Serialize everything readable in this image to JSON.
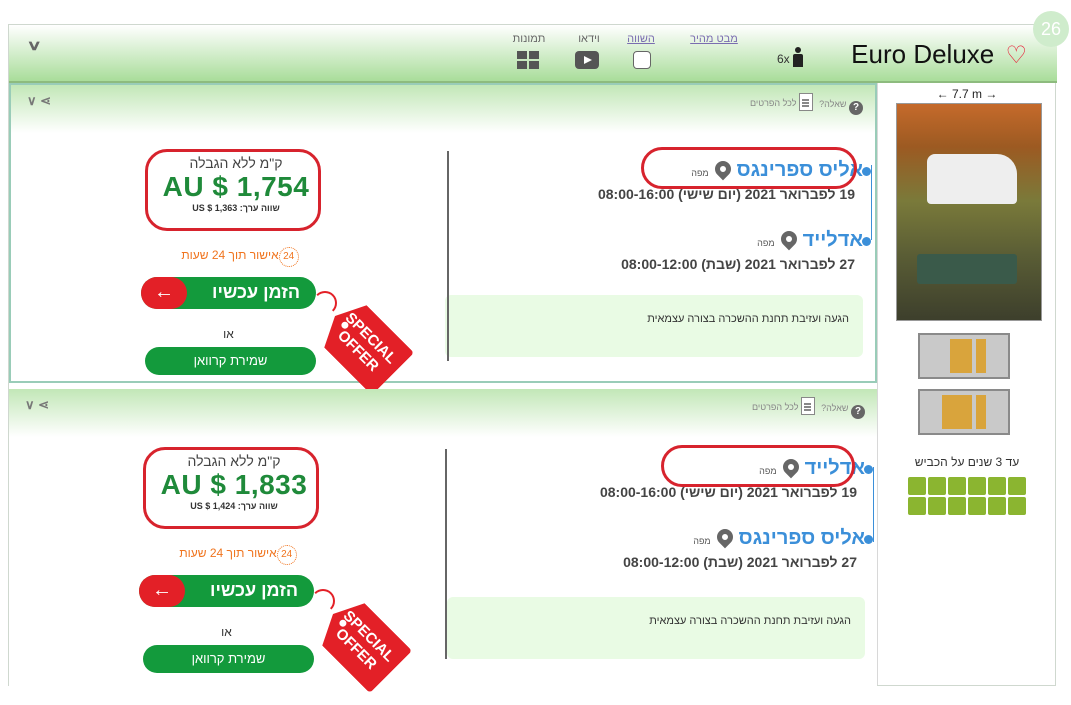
{
  "rank": "26",
  "vehicle": {
    "name": "Euro Deluxe",
    "heart": "♡",
    "passengers": "6x"
  },
  "header_links": {
    "quick_view": "מבט מהיר",
    "compare": "השווה",
    "video": "וידאו",
    "photos": "תמונות"
  },
  "offers": [
    {
      "question": "שאלה?",
      "details": "לכל הפרטים",
      "pickup": {
        "city": "אליס ספרינגס",
        "map": "מפה",
        "datetime": "19 לפברואר 2021 (יום שישי) 08:00-16:00"
      },
      "dropoff": {
        "city": "אדלייד",
        "map": "מפה",
        "datetime": "27 לפברואר 2021 (שבת) 08:00-12:00"
      },
      "note": "הגעה ועזיבת תחנת ההשכרה בצורה עצמאית",
      "unlimited": "ק\"מ ללא הגבלה",
      "price": "AU $ 1,754",
      "usd_value": "שווה ערך: US $ 1,363",
      "approval_hours": "24",
      "approval": "אישור תוך 24 שעות",
      "book_now": "הזמן עכשיו",
      "book_arrow": "←",
      "or": "או",
      "save": "שמירת קרוואן",
      "tag": "SPECIAL OFFER"
    },
    {
      "question": "שאלה?",
      "details": "לכל הפרטים",
      "pickup": {
        "city": "אדלייד",
        "map": "מפה",
        "datetime": "19 לפברואר 2021 (יום שישי) 08:00-16:00"
      },
      "dropoff": {
        "city": "אליס ספרינגס",
        "map": "מפה",
        "datetime": "27 לפברואר 2021 (שבת) 08:00-12:00"
      },
      "note": "הגעה ועזיבת תחנת ההשכרה בצורה עצמאית",
      "unlimited": "ק\"מ ללא הגבלה",
      "price": "AU $ 1,833",
      "usd_value": "שווה ערך: US $ 1,424",
      "approval_hours": "24",
      "approval": "אישור תוך 24 שעות",
      "book_now": "הזמן עכשיו",
      "book_arrow": "←",
      "or": "או",
      "save": "שמירת קרוואן",
      "tag": "SPECIAL OFFER"
    }
  ],
  "sidebar": {
    "length": "← 7.7 m →",
    "age": "עד 3 שנים על הכביש",
    "amenity_icons": 12
  },
  "colors": {
    "brand_green": "#139a3c",
    "price_green": "#1f8a3a",
    "accent_red": "#e32027",
    "link_blue": "#3b8fd9",
    "approval_orange": "#f0741e"
  }
}
